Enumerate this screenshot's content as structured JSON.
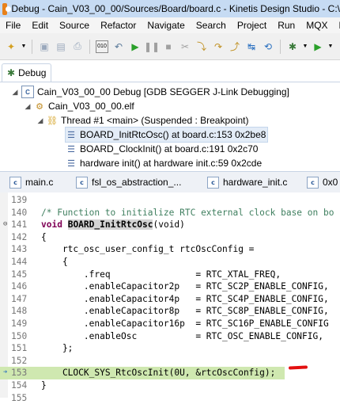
{
  "window": {
    "title": "Debug - Cain_V03_00_00/Sources/Board/board.c - Kinetis Design Studio - C:\\"
  },
  "menu": [
    "File",
    "Edit",
    "Source",
    "Refactor",
    "Navigate",
    "Search",
    "Project",
    "Run",
    "MQX",
    "Pr"
  ],
  "debug_view": {
    "tab_label": "Debug",
    "tree": [
      {
        "label": "Cain_V03_00_00 Debug [GDB SEGGER J-Link Debugging]"
      },
      {
        "label": "Cain_V03_00_00.elf"
      },
      {
        "label": "Thread #1 <main> (Suspended : Breakpoint)"
      },
      {
        "label": "BOARD_InitRtcOsc() at board.c:153 0x2be8"
      },
      {
        "label": "BOARD_ClockInit() at board.c:191 0x2c70"
      },
      {
        "label": "hardware init() at hardware init.c:59 0x2cde"
      }
    ]
  },
  "editor_tabs": [
    "main.c",
    "fsl_os_abstraction_...",
    "hardware_init.c",
    "0x0"
  ],
  "code": {
    "line_numbers": [
      "139",
      "140",
      "141",
      "142",
      "143",
      "144",
      "145",
      "146",
      "147",
      "148",
      "149",
      "150",
      "151",
      "152",
      "153",
      "154",
      "155"
    ],
    "l140": "/* Function to initialize RTC external clock base on bo",
    "l141_kw": "void",
    "l141_fn": "BOARD_InitRtcOsc",
    "l141_rest": "(void)",
    "l142": "{",
    "l143": "    rtc_osc_user_config_t rtcOscConfig =",
    "l144": "    {",
    "l145": "        .freq                = RTC_XTAL_FREQ,",
    "l146": "        .enableCapacitor2p   = RTC_SC2P_ENABLE_CONFIG,",
    "l147": "        .enableCapacitor4p   = RTC_SC4P_ENABLE_CONFIG,",
    "l148": "        .enableCapacitor8p   = RTC_SC8P_ENABLE_CONFIG,",
    "l149": "        .enableCapacitor16p  = RTC_SC16P_ENABLE_CONFIG",
    "l150": "        .enableOsc           = RTC_OSC_ENABLE_CONFIG,",
    "l151": "    };",
    "l152": "",
    "l153": "    CLOCK_SYS_RtcOscInit(0U, &rtcOscConfig);",
    "l154": "}",
    "l155": ""
  }
}
